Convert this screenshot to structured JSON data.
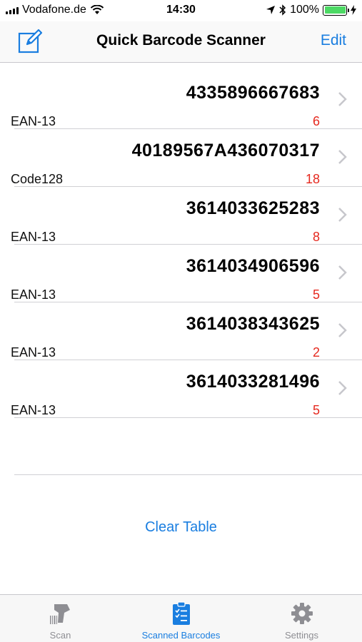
{
  "status_bar": {
    "carrier": "Vodafone.de",
    "time": "14:30",
    "battery": "100%"
  },
  "nav": {
    "title": "Quick Barcode Scanner",
    "edit_label": "Edit"
  },
  "barcodes": [
    {
      "code": "4335896667683",
      "type": "EAN-13",
      "count": "6"
    },
    {
      "code": "40189567A436070317",
      "type": "Code128",
      "count": "18"
    },
    {
      "code": "3614033625283",
      "type": "EAN-13",
      "count": "8"
    },
    {
      "code": "3614034906596",
      "type": "EAN-13",
      "count": "5"
    },
    {
      "code": "3614038343625",
      "type": "EAN-13",
      "count": "2"
    },
    {
      "code": "3614033281496",
      "type": "EAN-13",
      "count": "5"
    }
  ],
  "clear_table_label": "Clear Table",
  "tabs": [
    {
      "label": "Scan",
      "icon": "barcode-scanner-icon",
      "active": false
    },
    {
      "label": "Scanned Barcodes",
      "icon": "clipboard-icon",
      "active": true
    },
    {
      "label": "Settings",
      "icon": "gear-icon",
      "active": false
    }
  ],
  "colors": {
    "accent": "#1a7ee0",
    "count_red": "#e5291f",
    "battery_green": "#4cd964",
    "inactive_gray": "#8e8e93"
  }
}
